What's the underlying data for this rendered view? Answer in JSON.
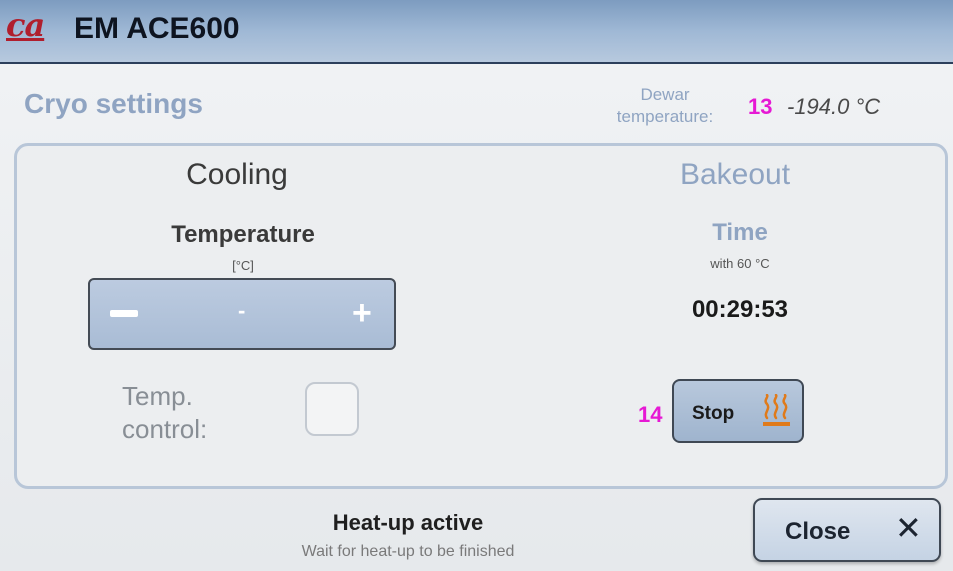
{
  "app": {
    "logo": "ca",
    "title": "EM ACE600"
  },
  "screen": {
    "title": "Cryo settings"
  },
  "dewar": {
    "label_line1": "Dewar",
    "label_line2": "temperature:",
    "value": "-194.0 °C"
  },
  "markers": {
    "dewar": "13",
    "stop": "14"
  },
  "cooling": {
    "header": "Cooling",
    "temperature_label": "Temperature",
    "unit": "[°C]",
    "stepper_value": "-",
    "temp_control_line1": "Temp.",
    "temp_control_line2": "control:",
    "temp_control_checked": false
  },
  "bakeout": {
    "header": "Bakeout",
    "time_label": "Time",
    "time_sublabel": "with 60 °C",
    "time_value": "00:29:53",
    "stop_label": "Stop",
    "heater_icon": "heater-icon"
  },
  "status": {
    "title": "Heat-up active",
    "subtitle": "Wait for heat-up to be finished"
  },
  "close": {
    "label": "Close",
    "icon": "close-icon"
  },
  "colors": {
    "accent": "#8fa4c2",
    "marker": "#e619d4",
    "brand": "#b01e2d",
    "heater": "#e07a1a"
  }
}
